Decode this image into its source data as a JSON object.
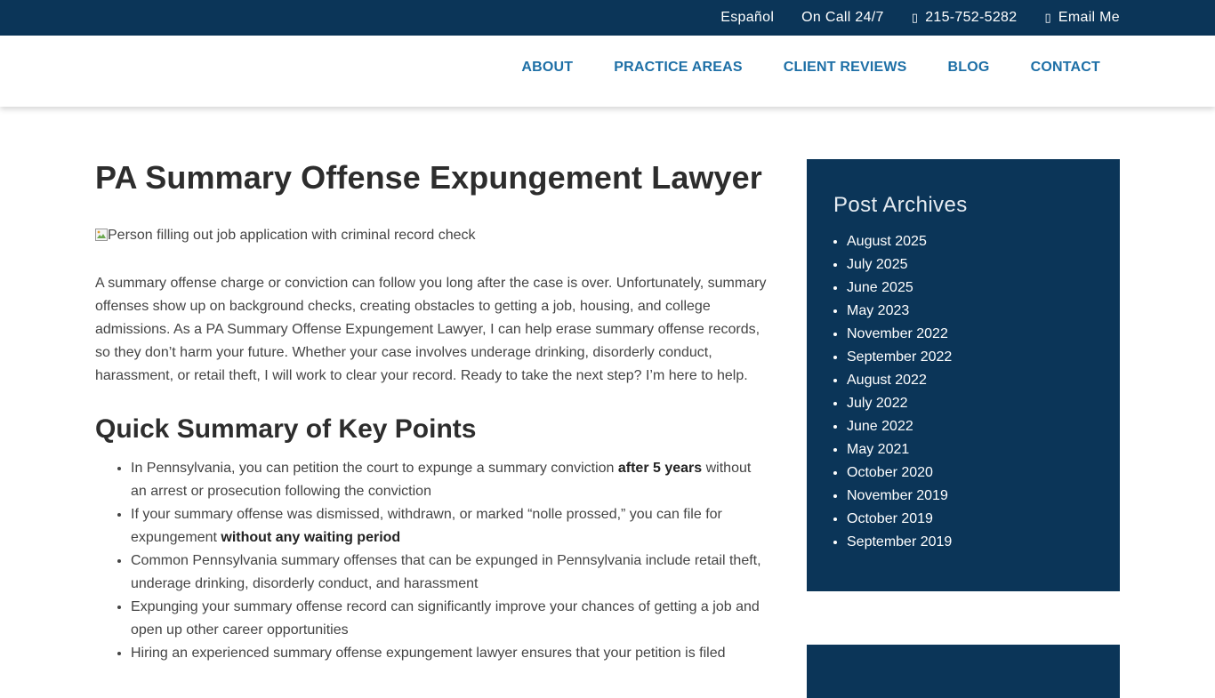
{
  "topbar": {
    "links": [
      {
        "label": "Español",
        "icon": ""
      },
      {
        "label": "On Call 24/7",
        "icon": ""
      },
      {
        "label": "215-752-5282",
        "icon": "phone-icon"
      },
      {
        "label": "Email Me",
        "icon": "envelope-icon"
      }
    ],
    "icon_glyph": ""
  },
  "nav": {
    "items": [
      "ABOUT",
      "PRACTICE AREAS",
      "CLIENT REVIEWS",
      "BLOG",
      "CONTACT"
    ]
  },
  "colors": {
    "primary_dark": "#0b3558",
    "nav_link": "#1d6fa6",
    "body_text": "#444444"
  },
  "main": {
    "title": "PA Summary Offense Expungement Lawyer",
    "image_alt": "Person filling out job application with criminal record check",
    "intro": "A summary offense charge or conviction can follow you long after the case is over.  Unfortunately, summary offenses show up on background checks, creating obstacles to getting a job, housing, and college admissions.  As a PA Summary Offense Expungement Lawyer, I can help erase summary offense records, so they don’t harm your future.  Whether your case involves underage drinking, disorderly conduct, harassment, or retail theft, I will work to clear your record.  Ready to take the next step?  I’m here to help.",
    "section_title": "Quick Summary of Key Points",
    "key_points": [
      {
        "before": "In Pennsylvania, you can petition the court to expunge a summary conviction ",
        "bold": "after 5 years",
        "after": " without an arrest or prosecution following the conviction"
      },
      {
        "before": "If your summary offense was dismissed, withdrawn, or marked “nolle prossed,” you can file for expungement ",
        "bold": "without any waiting period",
        "after": ""
      },
      {
        "before": "Common Pennsylvania summary offenses that can be expunged in Pennsylvania include retail theft, underage drinking, disorderly conduct, and harassment",
        "bold": "",
        "after": ""
      },
      {
        "before": "Expunging your summary offense record can significantly improve your chances of getting a job and open up other career opportunities",
        "bold": "",
        "after": ""
      },
      {
        "before": "Hiring an experienced summary offense expungement lawyer ensures that your petition is filed",
        "bold": "",
        "after": ""
      }
    ]
  },
  "sidebar": {
    "title": "Post Archives",
    "archives": [
      "August 2025",
      "July 2025",
      "June 2025",
      "May 2023",
      "November 2022",
      "September 2022",
      "August 2022",
      "July 2022",
      "June 2022",
      "May 2021",
      "October 2020",
      "November 2019",
      "October 2019",
      "September 2019"
    ]
  }
}
